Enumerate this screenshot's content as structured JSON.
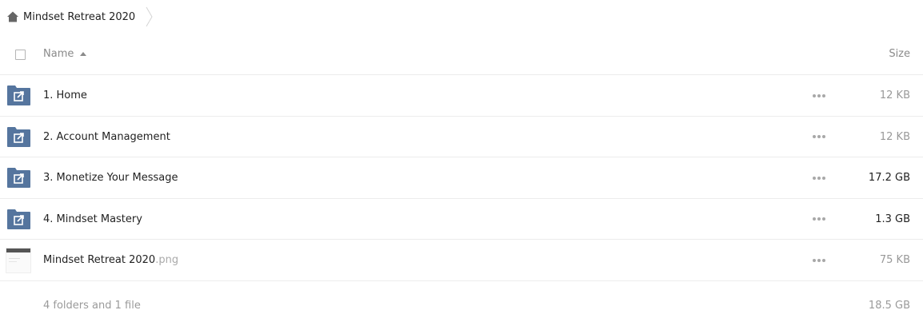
{
  "breadcrumb": {
    "home_label": "Mindset Retreat 2020"
  },
  "header": {
    "name_label": "Name",
    "size_label": "Size"
  },
  "rows": [
    {
      "name": "1. Home",
      "ext": "",
      "size": "12 KB",
      "type": "folder-link"
    },
    {
      "name": "2. Account Management",
      "ext": "",
      "size": "12 KB",
      "type": "folder-link"
    },
    {
      "name": "3. Monetize Your Message",
      "ext": "",
      "size": "17.2 GB",
      "type": "folder-link"
    },
    {
      "name": "4. Mindset Mastery",
      "ext": "",
      "size": "1.3 GB",
      "type": "folder-link"
    },
    {
      "name": "Mindset Retreat 2020",
      "ext": ".png",
      "size": "75 KB",
      "type": "image-thumbnail"
    }
  ],
  "footer": {
    "summary": "4 folders and 1 file",
    "total": "18.5 GB"
  },
  "colors": {
    "folder_icon": "#55759e",
    "text": "#222222",
    "muted": "#9a9a9a"
  }
}
